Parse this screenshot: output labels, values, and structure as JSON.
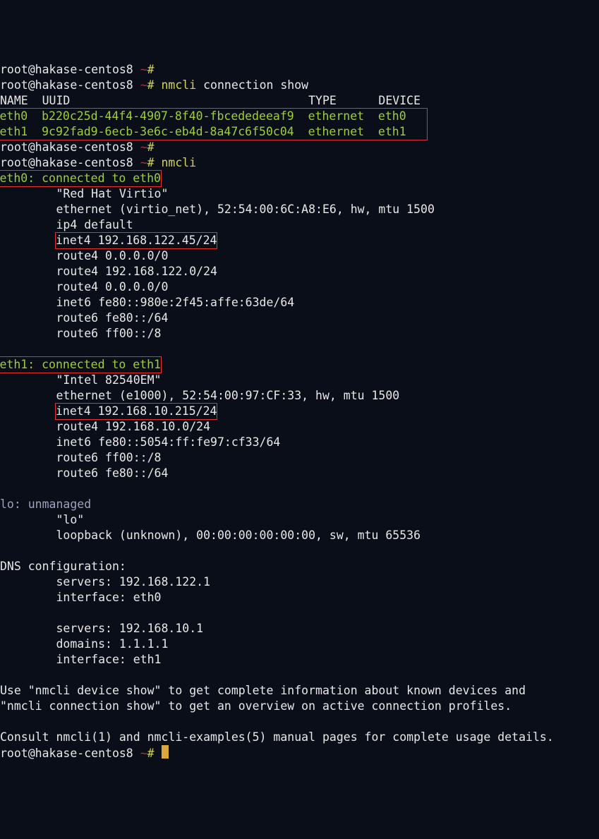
{
  "prompts": {
    "user": "root@hakase-centos8",
    "tilde": "~",
    "hash": "#"
  },
  "commands": {
    "cmd1": "nmcli",
    "cmd1_args": " connection show",
    "cmd2": "nmcli"
  },
  "table": {
    "header": "NAME  UUID                                  TYPE      DEVICE ",
    "row1": "eth0  b220c25d-44f4-4907-8f40-fbcededeeaf9  ethernet  eth0   ",
    "row2": "eth1  9c92fad9-6ecb-3e6c-eb4d-8a47c6f50c04  ethernet  eth1   "
  },
  "eth0": {
    "header": "eth0: connected to eth0",
    "l1": "        \"Red Hat Virtio\"",
    "l2": "        ethernet (virtio_net), 52:54:00:6C:A8:E6, hw, mtu 1500",
    "l3": "        ip4 default",
    "ip_pre": "        ",
    "ip": "inet4 192.168.122.45/24",
    "l5": "        route4 0.0.0.0/0",
    "l6": "        route4 192.168.122.0/24",
    "l7": "        route4 0.0.0.0/0",
    "l8": "        inet6 fe80::980e:2f45:affe:63de/64",
    "l9": "        route6 fe80::/64",
    "l10": "        route6 ff00::/8"
  },
  "eth1": {
    "header": "eth1: connected to eth1",
    "l1": "        \"Intel 82540EM\"",
    "l2": "        ethernet (e1000), 52:54:00:97:CF:33, hw, mtu 1500",
    "ip_pre": "        ",
    "ip": "inet4 192.168.10.215/24",
    "l4": "        route4 192.168.10.0/24",
    "l5": "        inet6 fe80::5054:ff:fe97:cf33/64",
    "l6": "        route6 ff00::/8",
    "l7": "        route6 fe80::/64"
  },
  "lo": {
    "header": "lo: unmanaged",
    "l1": "        \"lo\"",
    "l2": "        loopback (unknown), 00:00:00:00:00:00, sw, mtu 65536"
  },
  "dns": {
    "header": "DNS configuration:",
    "l1": "        servers: 192.168.122.1",
    "l2": "        interface: eth0",
    "l4": "        servers: 192.168.10.1",
    "l5": "        domains: 1.1.1.1",
    "l6": "        interface: eth1"
  },
  "hints": {
    "l1": "Use \"nmcli device show\" to get complete information about known devices and",
    "l2": "\"nmcli connection show\" to get an overview on active connection profiles.",
    "l4": "Consult nmcli(1) and nmcli-examples(5) manual pages for complete usage details."
  }
}
